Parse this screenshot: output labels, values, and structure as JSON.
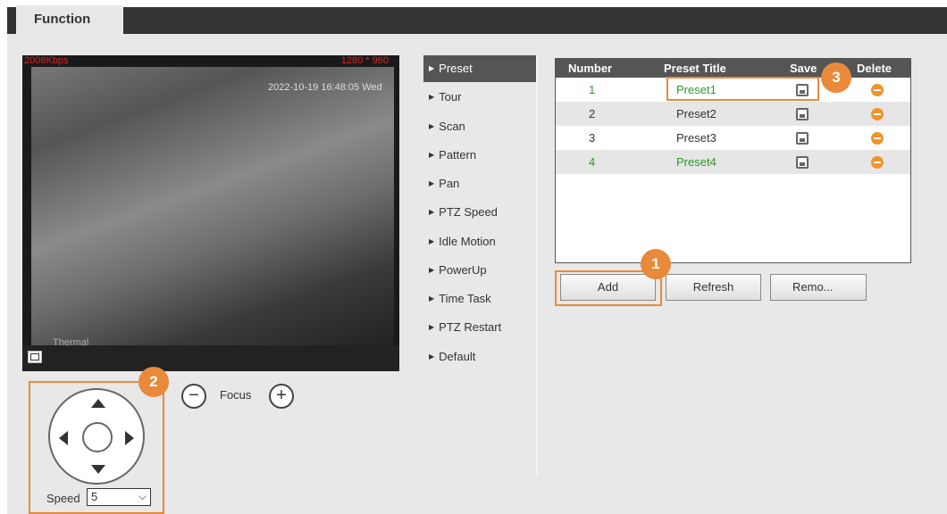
{
  "header": {
    "tab_function": "Function"
  },
  "video": {
    "bitrate": "2008Kbps",
    "resolution": "1280 * 960",
    "timestamp": "2022-10-19 16:48:05 Wed",
    "channel": "Thermal"
  },
  "ptz": {
    "speed_label": "Speed",
    "speed_value": "5",
    "focus_label": "Focus",
    "focus_minus": "−",
    "focus_plus": "+"
  },
  "menu": {
    "items": [
      {
        "label": "Preset",
        "active": true
      },
      {
        "label": "Tour"
      },
      {
        "label": "Scan"
      },
      {
        "label": "Pattern"
      },
      {
        "label": "Pan"
      },
      {
        "label": "PTZ Speed"
      },
      {
        "label": "Idle Motion"
      },
      {
        "label": "PowerUp"
      },
      {
        "label": "Time Task"
      },
      {
        "label": "PTZ Restart"
      },
      {
        "label": "Default"
      }
    ]
  },
  "table": {
    "headers": {
      "number": "Number",
      "title": "Preset Title",
      "save": "Save",
      "delete": "Delete"
    },
    "rows": [
      {
        "number": "1",
        "title": "Preset1",
        "highlight": true
      },
      {
        "number": "2",
        "title": "Preset2",
        "highlight": false
      },
      {
        "number": "3",
        "title": "Preset3",
        "highlight": false
      },
      {
        "number": "4",
        "title": "Preset4",
        "highlight": true
      }
    ],
    "highlight_color": "#2a9a2a"
  },
  "buttons": {
    "add": "Add",
    "refresh": "Refresh",
    "remove": "Remo..."
  },
  "callouts": {
    "one": "1",
    "two": "2",
    "three": "3"
  },
  "colors": {
    "accent": "#e88a3a",
    "active_menu": "#555555",
    "delete": "#f0952a"
  }
}
